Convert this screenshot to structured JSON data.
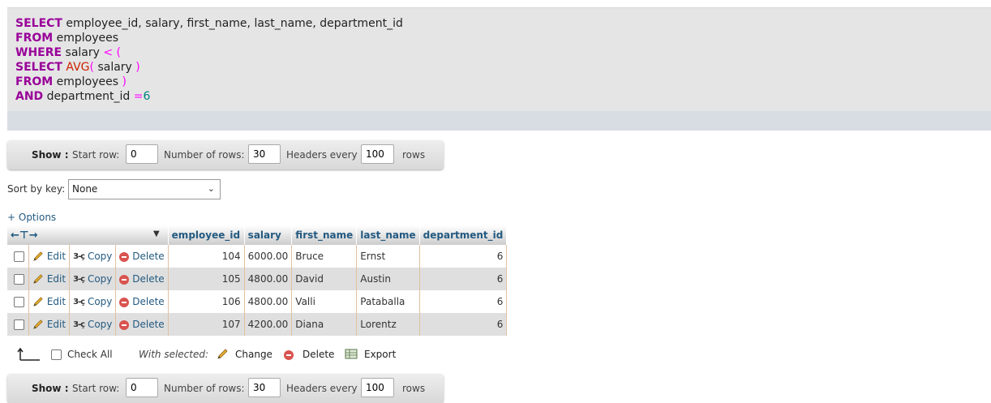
{
  "sql": {
    "line1": {
      "kw": "SELECT",
      "rest": " employee_id, salary, first_name, last_name, department_id"
    },
    "line2": {
      "kw": "FROM",
      "rest": " employees"
    },
    "line3": {
      "kw": "WHERE",
      "rest": " salary ",
      "punct": "< ("
    },
    "line4": {
      "kw": "SELECT",
      "fn": " AVG",
      "p1": "(",
      "rest": " salary ",
      "p2": ")"
    },
    "line5": {
      "kw": "FROM",
      "rest": " employees ",
      "punct": ")"
    },
    "line6": {
      "kw": "AND",
      "rest": " department_id ",
      "op": "=",
      "num": "6"
    }
  },
  "navbar": {
    "show_label": "Show :",
    "start_row_label": "Start row:",
    "start_row_value": "0",
    "num_rows_label": "Number of rows:",
    "num_rows_value": "30",
    "headers_every_label": "Headers every",
    "headers_every_value": "100",
    "rows_label": "rows"
  },
  "sort": {
    "label": "Sort by key:",
    "selected": "None"
  },
  "options_link": "+ Options",
  "table": {
    "columns": [
      "employee_id",
      "salary",
      "first_name",
      "last_name",
      "department_id"
    ],
    "actions": {
      "edit": "Edit",
      "copy": "Copy",
      "delete": "Delete"
    },
    "rows": [
      {
        "employee_id": "104",
        "salary": "6000.00",
        "first_name": "Bruce",
        "last_name": "Ernst",
        "department_id": "6"
      },
      {
        "employee_id": "105",
        "salary": "4800.00",
        "first_name": "David",
        "last_name": "Austin",
        "department_id": "6"
      },
      {
        "employee_id": "106",
        "salary": "4800.00",
        "first_name": "Valli",
        "last_name": "Pataballa",
        "department_id": "6"
      },
      {
        "employee_id": "107",
        "salary": "4200.00",
        "first_name": "Diana",
        "last_name": "Lorentz",
        "department_id": "6"
      }
    ]
  },
  "bulk": {
    "check_all": "Check All",
    "with_selected": "With selected:",
    "change": "Change",
    "delete": "Delete",
    "export": "Export"
  },
  "colors": {
    "link": "#235a81",
    "keyword": "#990099",
    "function": "#cc2200",
    "delete_icon": "#d9534f"
  }
}
